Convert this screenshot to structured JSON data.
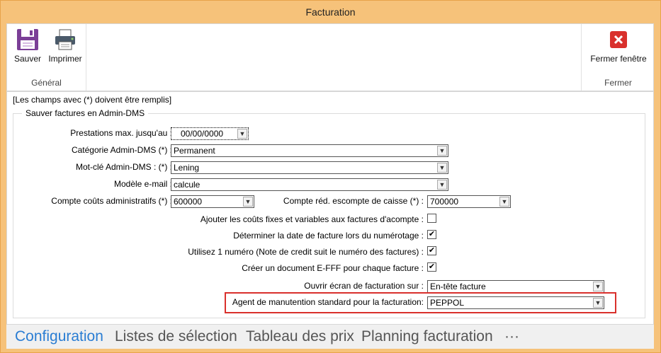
{
  "window": {
    "title": "Facturation"
  },
  "ribbon": {
    "save_label": "Sauver",
    "print_label": "Imprimer",
    "group_general": "Général",
    "close_label": "Fermer fenêtre",
    "group_close": "Fermer"
  },
  "form": {
    "required_note": "[Les champs avec (*) doivent être remplis]",
    "section_title": "Sauver factures en Admin-DMS",
    "fields": {
      "prestations_label": "Prestations max. jusqu'au :",
      "prestations_value": "00/00/0000",
      "categorie_label": "Catégorie Admin-DMS (*) :",
      "categorie_value": "Permanent",
      "motcle_label": "Mot-clé Admin-DMS : (*) :",
      "motcle_value": "Lening",
      "modele_label": "Modèle e-mail :",
      "modele_value": "calcule",
      "couts_label": "Compte coûts administratifs (*) :",
      "couts_value": "600000",
      "escompte_label": "Compte réd. escompte de caisse (*) :",
      "escompte_value": "700000",
      "ajouter_label": "Ajouter les coûts fixes et variables aux factures d'acompte :",
      "ajouter_checked": false,
      "determiner_label": "Déterminer la date de facture lors du numérotage :",
      "determiner_checked": true,
      "utilisez_label": "Utilisez 1 numéro (Note de credit suit le numéro des factures) :",
      "utilisez_checked": true,
      "creer_label": "Créer un document E-FFF pour chaque facture :",
      "creer_checked": true,
      "ouvrir_label": "Ouvrir écran de facturation sur :",
      "ouvrir_value": "En-tête facture",
      "agent_label": "Agent de manutention standard pour la facturation:",
      "agent_value": "PEPPOL"
    }
  },
  "tabs": [
    "Configuration",
    "Listes de sélection",
    "Tableau des prix",
    "Planning facturation",
    "···"
  ],
  "colors": {
    "accent": "#2a7dd3",
    "highlight": "#d9302c",
    "frame": "#f6c27a"
  }
}
